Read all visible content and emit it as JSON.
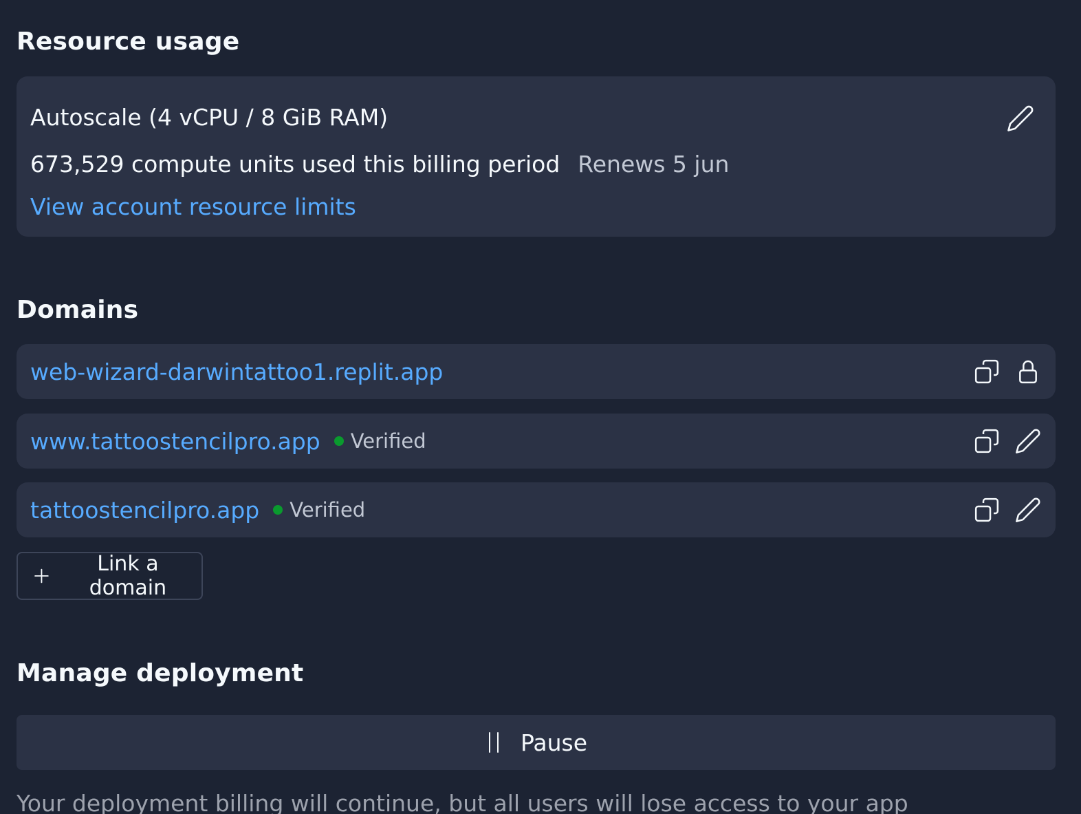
{
  "resource": {
    "heading": "Resource usage",
    "plan": "Autoscale (4 vCPU / 8 GiB RAM)",
    "usage": "673,529 compute units used this billing period",
    "renews": "Renews 5 jun",
    "link": "View account resource limits",
    "edit_icon": "pencil-icon"
  },
  "domains": {
    "heading": "Domains",
    "rows": [
      {
        "url": "web-wizard-darwintattoo1.replit.app",
        "status": "",
        "actions": [
          "copy-icon",
          "lock-icon"
        ]
      },
      {
        "url": "www.tattoostencilpro.app",
        "status": "Verified",
        "actions": [
          "copy-icon",
          "pencil-icon"
        ]
      },
      {
        "url": "tattoostencilpro.app",
        "status": "Verified",
        "actions": [
          "copy-icon",
          "pencil-icon"
        ]
      }
    ],
    "link_button": "Link a domain",
    "status_color": "#0a9a2e"
  },
  "manage": {
    "heading": "Manage deployment",
    "pause_label": "Pause",
    "note": "Your deployment billing will continue, but all users will lose access to your app"
  },
  "colors": {
    "background": "#1c2333",
    "card": "#2b3245",
    "link": "#57abff",
    "muted": "#c2c8d4"
  }
}
